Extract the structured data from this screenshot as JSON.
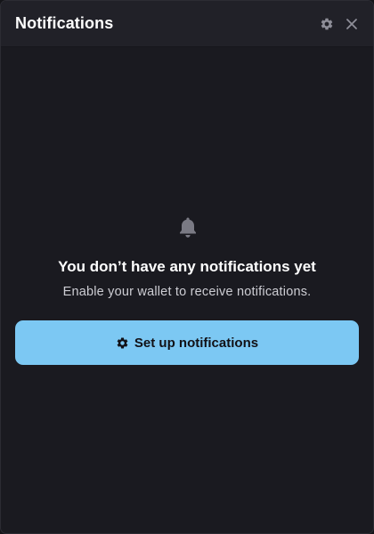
{
  "header": {
    "title": "Notifications",
    "settings_icon": "gear-icon",
    "close_icon": "close-icon"
  },
  "empty_state": {
    "icon": "bell-icon",
    "title": "You don’t have any notifications yet",
    "subtitle": "Enable your wallet to receive notifications."
  },
  "setup_button": {
    "icon": "gear-icon",
    "label": "Set up notifications"
  },
  "colors": {
    "background": "#1a1a20",
    "header_background": "#212128",
    "accent_button": "#7cc8f3",
    "muted_icon": "#8e8e98"
  }
}
